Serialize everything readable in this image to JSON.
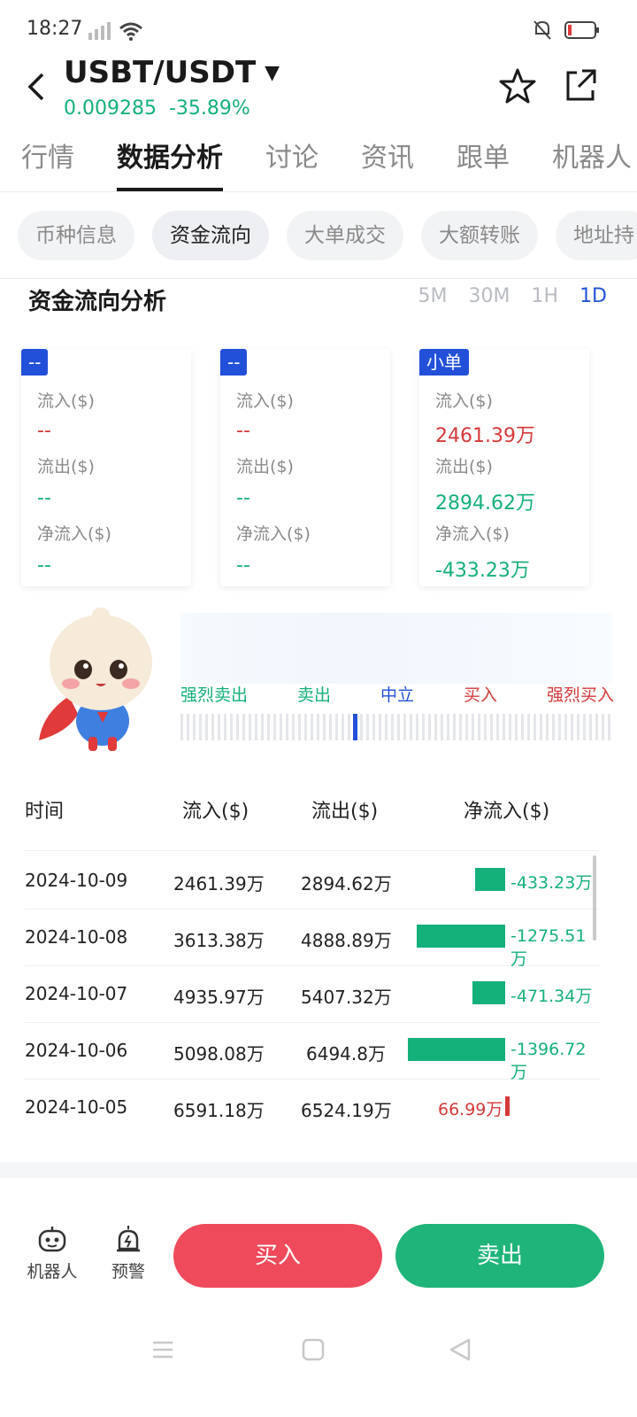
{
  "status_bar": {
    "time": "18:27"
  },
  "header": {
    "pair": "USBT/USDT",
    "price": "0.009285",
    "change": "-35.89%"
  },
  "main_tabs": [
    "行情",
    "数据分析",
    "讨论",
    "资讯",
    "跟单",
    "机器人"
  ],
  "sub_tabs": [
    "币种信息",
    "资金流向",
    "大单成交",
    "大额转账",
    "地址持"
  ],
  "section": {
    "title": "资金流向分析",
    "periods": [
      "5M",
      "30M",
      "1H",
      "1D"
    ]
  },
  "cards": [
    {
      "tag": "--",
      "inflow_label": "流入($)",
      "inflow": "--",
      "outflow_label": "流出($)",
      "outflow": "--",
      "net_label": "净流入($)",
      "net": "--"
    },
    {
      "tag": "--",
      "inflow_label": "流入($)",
      "inflow": "--",
      "outflow_label": "流出($)",
      "outflow": "--",
      "net_label": "净流入($)",
      "net": "--"
    },
    {
      "tag": "小单",
      "inflow_label": "流入($)",
      "inflow": "2461.39万",
      "outflow_label": "流出($)",
      "outflow": "2894.62万",
      "net_label": "净流入($)",
      "net": "-433.23万"
    }
  ],
  "sentiment": {
    "labels": [
      "强烈卖出",
      "卖出",
      "中立",
      "买入",
      "强烈买入"
    ],
    "level": 0.4
  },
  "table": {
    "headers": [
      "时间",
      "流入($)",
      "流出($)",
      "净流入($)"
    ],
    "rows": [
      {
        "date": "2024-10-09",
        "inflow": "2461.39万",
        "outflow": "2894.62万",
        "net": "-433.23万",
        "net_value": -433.23
      },
      {
        "date": "2024-10-08",
        "inflow": "3613.38万",
        "outflow": "4888.89万",
        "net": "-1275.51万",
        "net_value": -1275.51
      },
      {
        "date": "2024-10-07",
        "inflow": "4935.97万",
        "outflow": "5407.32万",
        "net": "-471.34万",
        "net_value": -471.34
      },
      {
        "date": "2024-10-06",
        "inflow": "5098.08万",
        "outflow": "6494.8万",
        "net": "-1396.72万",
        "net_value": -1396.72
      },
      {
        "date": "2024-10-05",
        "inflow": "6591.18万",
        "outflow": "6524.19万",
        "net": "66.99万",
        "net_value": 66.99
      }
    ]
  },
  "bottom_bar": {
    "robot_label": "机器人",
    "alert_label": "预警",
    "buy_label": "买入",
    "sell_label": "卖出"
  },
  "colors": {
    "up": "#d63a3a",
    "down": "#14b07a",
    "accent": "#2250d9",
    "buy": "#ef4a5c",
    "sell": "#1fb479"
  }
}
